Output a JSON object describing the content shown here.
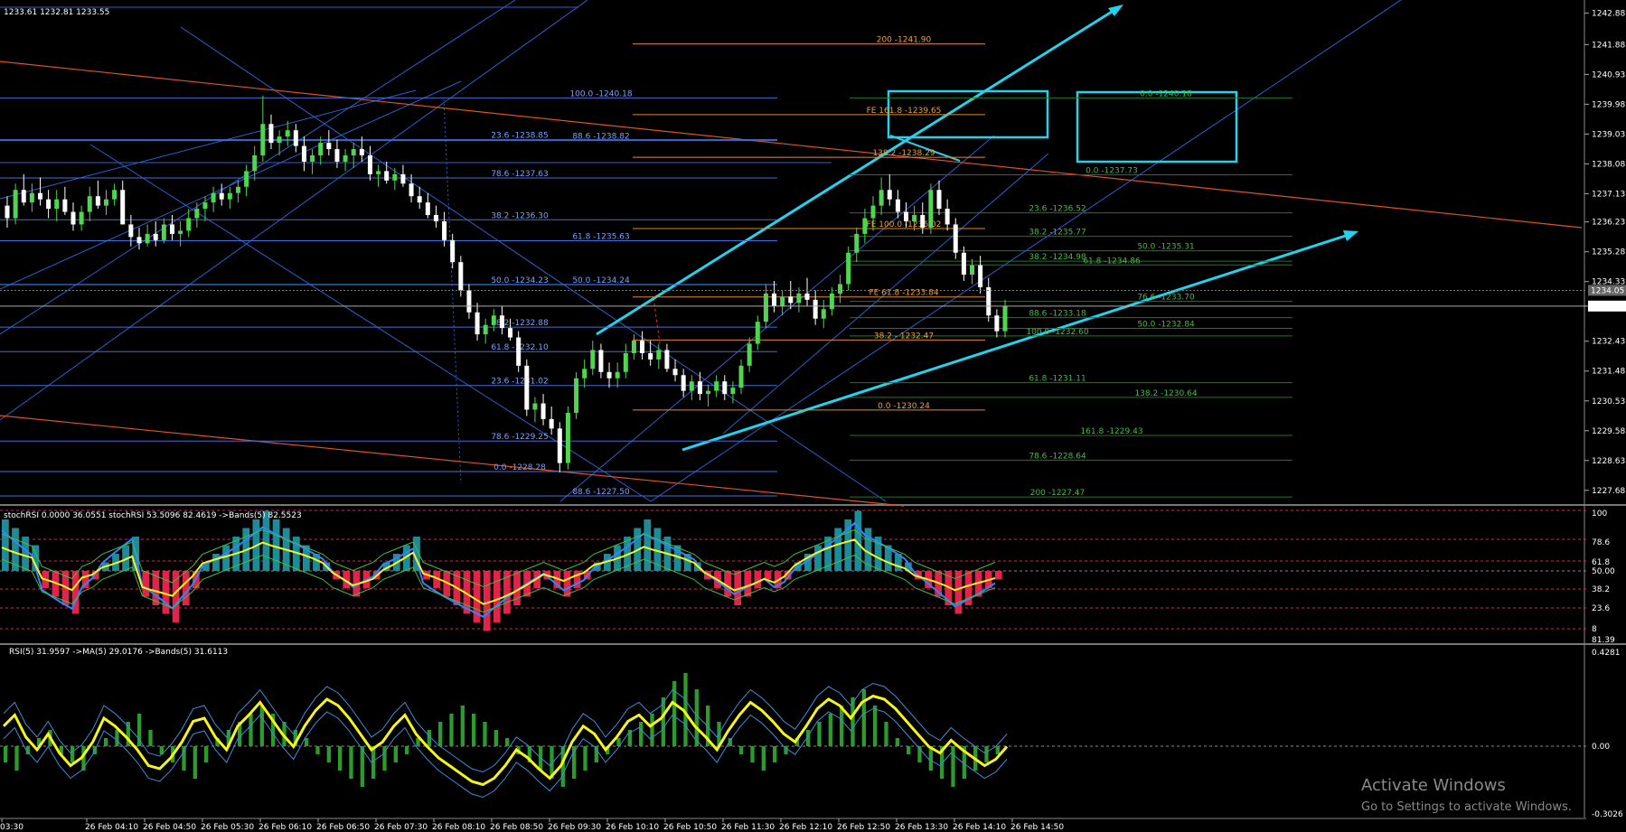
{
  "header": {
    "ohlc": "1233.61 1232.81 1233.55"
  },
  "colors": {
    "bull": "#4fd64f",
    "bear": "#ffffff",
    "blueline": "#2d5fcf",
    "orange": "#e08a2c",
    "green": "#1c7d1c",
    "cyan": "#22d3ee",
    "red": "#e0244a",
    "yellow": "#f5f51a",
    "stochblue": "#2e86ff"
  },
  "price_axis": {
    "ticks": [
      "1242.88",
      "1241.88",
      "1240.93",
      "1239.98",
      "1239.03",
      "1238.08",
      "1237.13",
      "1236.23",
      "1235.28",
      "1234.33",
      "1233.55",
      "1232.43",
      "1231.48",
      "1230.53",
      "1229.58",
      "1228.63",
      "1227.68"
    ],
    "current_price": "1233.55",
    "marker_price": "1234.05"
  },
  "stoch_axis": {
    "ticks": [
      "100",
      "78.6",
      "61.8",
      "50.00",
      "38.2",
      "23.6",
      "8",
      "81.39"
    ]
  },
  "rsi_axis": {
    "ticks": [
      "0.4281",
      "0.00",
      "-0.3026"
    ]
  },
  "time_axis": {
    "labels": [
      "03:30",
      "26 Feb 04:10",
      "26 Feb 04:50",
      "26 Feb 05:30",
      "26 Feb 06:10",
      "26 Feb 06:50",
      "26 Feb 07:30",
      "26 Feb 08:10",
      "26 Feb 08:50",
      "26 Feb 09:30",
      "26 Feb 10:10",
      "26 Feb 10:50",
      "26 Feb 11:30",
      "26 Feb 12:10",
      "26 Feb 12:50",
      "26 Feb 13:30",
      "26 Feb 14:10",
      "26 Feb 14:50"
    ]
  },
  "fib_labels": [
    {
      "text": "200 -1241.90",
      "price": 1241.9,
      "color": "orange"
    },
    {
      "text": "100.0 -1240.18",
      "price": 1240.18,
      "color": "blue"
    },
    {
      "text": "0.0 -1240.18",
      "price": 1240.18,
      "color": "green"
    },
    {
      "text": "FE 161.8 -1239.65",
      "price": 1239.65,
      "color": "orange"
    },
    {
      "text": "23.6 -1238.85",
      "price": 1238.85,
      "color": "blue"
    },
    {
      "text": "88.6 -1238.82",
      "price": 1238.82,
      "color": "blue"
    },
    {
      "text": "138.2 -1238.29",
      "price": 1238.29,
      "color": "orange"
    },
    {
      "text": "0.0 -1237.73",
      "price": 1237.73,
      "color": "green"
    },
    {
      "text": "78.6 -1237.63",
      "price": 1237.63,
      "color": "blue"
    },
    {
      "text": "23.6 -1236.52",
      "price": 1236.52,
      "color": "green"
    },
    {
      "text": "38.2 -1236.30",
      "price": 1236.3,
      "color": "blue"
    },
    {
      "text": "FE 100.0 -1236.02",
      "price": 1236.02,
      "color": "orange"
    },
    {
      "text": "38.2 -1235.77",
      "price": 1235.77,
      "color": "green"
    },
    {
      "text": "61.8 -1235.63",
      "price": 1235.63,
      "color": "blue"
    },
    {
      "text": "50.0 -1235.31",
      "price": 1235.31,
      "color": "green"
    },
    {
      "text": "38.2 -1234.98",
      "price": 1234.98,
      "color": "green"
    },
    {
      "text": "61.8 -1234.86",
      "price": 1234.86,
      "color": "green"
    },
    {
      "text": "50.0 -1234.24",
      "price": 1234.24,
      "color": "blue"
    },
    {
      "text": "50.0 -1234.23",
      "price": 1234.23,
      "color": "blue"
    },
    {
      "text": "FE 61.8 -1233.84",
      "price": 1233.84,
      "color": "orange"
    },
    {
      "text": "76.6 -1233.70",
      "price": 1233.7,
      "color": "green"
    },
    {
      "text": "88.6 -1233.18",
      "price": 1233.18,
      "color": "green"
    },
    {
      "text": "38.2 -1232.88",
      "price": 1232.88,
      "color": "blue"
    },
    {
      "text": "50.0 -1232.84",
      "price": 1232.84,
      "color": "green"
    },
    {
      "text": "100.0 -1232.60",
      "price": 1232.6,
      "color": "green"
    },
    {
      "text": "38.2 - 1232.47",
      "price": 1232.47,
      "color": "orange"
    },
    {
      "text": "61.8 -1232.10",
      "price": 1232.1,
      "color": "blue"
    },
    {
      "text": "61.8 -1231.11",
      "price": 1231.11,
      "color": "green"
    },
    {
      "text": "23.6 -1231.02",
      "price": 1231.02,
      "color": "blue"
    },
    {
      "text": "138.2 -1230.64",
      "price": 1230.64,
      "color": "green"
    },
    {
      "text": "0.0 -1230.24",
      "price": 1230.24,
      "color": "orange"
    },
    {
      "text": "161.8 -1229.43",
      "price": 1229.43,
      "color": "green"
    },
    {
      "text": "78.6 -1229.25",
      "price": 1229.25,
      "color": "blue"
    },
    {
      "text": "78.6 -1228.64",
      "price": 1228.64,
      "color": "green"
    },
    {
      "text": "0.0 -1228.28",
      "price": 1228.28,
      "color": "blue"
    },
    {
      "text": "88.6 -1227.50",
      "price": 1227.5,
      "color": "blue"
    },
    {
      "text": "200 -1227.47",
      "price": 1227.47,
      "color": "green"
    }
  ],
  "stoch_legend": "stochRSI 0.0000 36.0551  stochRSI 53.5096 82.4619  ->Bands(5) 82.5523",
  "rsi_legend": "RSI(5) 31.9597  ->MA(5) 29.0176  ->Bands(5) 31.6113",
  "watermark": {
    "title": "Activate Windows",
    "subtitle": "Go to Settings to activate Windows."
  },
  "chart_data": {
    "type": "candlestick",
    "price_range": [
      1227.3,
      1243.3
    ],
    "ohlc": [
      [
        1236.75,
        1237.05,
        1236.05,
        1236.35
      ],
      [
        1236.35,
        1237.45,
        1236.15,
        1237.25
      ],
      [
        1237.25,
        1237.75,
        1236.75,
        1236.85
      ],
      [
        1236.85,
        1237.45,
        1236.55,
        1237.15
      ],
      [
        1237.15,
        1237.65,
        1236.75,
        1236.95
      ],
      [
        1236.95,
        1237.25,
        1236.35,
        1236.65
      ],
      [
        1236.65,
        1237.25,
        1236.25,
        1236.95
      ],
      [
        1236.95,
        1237.35,
        1236.45,
        1236.55
      ],
      [
        1236.55,
        1236.85,
        1235.95,
        1236.15
      ],
      [
        1236.15,
        1236.75,
        1235.95,
        1236.55
      ],
      [
        1236.55,
        1237.35,
        1236.25,
        1237.05
      ],
      [
        1237.05,
        1237.55,
        1236.65,
        1236.75
      ],
      [
        1236.75,
        1237.25,
        1236.45,
        1236.95
      ],
      [
        1236.95,
        1237.45,
        1236.75,
        1237.25
      ],
      [
        1237.25,
        1237.55,
        1236.45,
        1236.15
      ],
      [
        1236.15,
        1236.45,
        1235.45,
        1235.75
      ],
      [
        1235.75,
        1236.05,
        1235.35,
        1235.55
      ],
      [
        1235.55,
        1236.15,
        1235.45,
        1235.85
      ],
      [
        1235.85,
        1236.25,
        1235.45,
        1235.65
      ],
      [
        1235.65,
        1236.35,
        1235.55,
        1236.15
      ],
      [
        1236.15,
        1236.45,
        1235.65,
        1235.85
      ],
      [
        1235.85,
        1236.25,
        1235.45,
        1235.95
      ],
      [
        1235.95,
        1236.65,
        1235.75,
        1236.35
      ],
      [
        1236.35,
        1236.85,
        1236.05,
        1236.65
      ],
      [
        1236.65,
        1237.05,
        1236.25,
        1236.85
      ],
      [
        1236.85,
        1237.35,
        1236.55,
        1237.15
      ],
      [
        1237.15,
        1237.45,
        1236.75,
        1236.95
      ],
      [
        1236.95,
        1237.35,
        1236.65,
        1237.15
      ],
      [
        1237.15,
        1237.55,
        1236.85,
        1237.35
      ],
      [
        1237.35,
        1238.05,
        1237.05,
        1237.85
      ],
      [
        1237.85,
        1238.65,
        1237.55,
        1238.35
      ],
      [
        1238.35,
        1240.25,
        1238.15,
        1239.35
      ],
      [
        1239.35,
        1239.65,
        1238.55,
        1238.75
      ],
      [
        1238.75,
        1239.15,
        1238.35,
        1238.95
      ],
      [
        1238.95,
        1239.45,
        1238.65,
        1239.15
      ],
      [
        1239.15,
        1239.35,
        1238.45,
        1238.65
      ],
      [
        1238.65,
        1238.95,
        1237.85,
        1238.15
      ],
      [
        1238.15,
        1238.55,
        1237.75,
        1238.35
      ],
      [
        1238.35,
        1238.95,
        1238.05,
        1238.75
      ],
      [
        1238.75,
        1239.15,
        1238.35,
        1238.55
      ],
      [
        1238.55,
        1238.85,
        1237.95,
        1238.15
      ],
      [
        1238.15,
        1238.55,
        1237.85,
        1238.35
      ],
      [
        1238.35,
        1238.75,
        1237.95,
        1238.55
      ],
      [
        1238.55,
        1238.95,
        1238.15,
        1238.35
      ],
      [
        1238.35,
        1238.65,
        1237.55,
        1237.75
      ],
      [
        1237.75,
        1238.05,
        1237.35,
        1237.85
      ],
      [
        1237.85,
        1238.15,
        1237.45,
        1237.55
      ],
      [
        1237.55,
        1237.95,
        1237.25,
        1237.75
      ],
      [
        1237.75,
        1238.05,
        1237.35,
        1237.45
      ],
      [
        1237.45,
        1237.75,
        1236.85,
        1237.05
      ],
      [
        1237.05,
        1237.35,
        1236.65,
        1236.85
      ],
      [
        1236.85,
        1237.15,
        1236.35,
        1236.45
      ],
      [
        1236.45,
        1236.75,
        1236.05,
        1236.25
      ],
      [
        1236.25,
        1236.55,
        1235.45,
        1235.65
      ],
      [
        1235.65,
        1235.85,
        1234.75,
        1234.95
      ],
      [
        1234.95,
        1235.15,
        1233.85,
        1234.05
      ],
      [
        1234.05,
        1234.25,
        1233.15,
        1233.35
      ],
      [
        1233.35,
        1233.65,
        1232.45,
        1232.65
      ],
      [
        1232.65,
        1233.15,
        1232.35,
        1232.95
      ],
      [
        1232.95,
        1233.45,
        1232.75,
        1233.25
      ],
      [
        1233.25,
        1233.55,
        1232.65,
        1232.85
      ],
      [
        1232.85,
        1233.15,
        1232.45,
        1232.55
      ],
      [
        1232.55,
        1232.75,
        1231.45,
        1231.65
      ],
      [
        1231.65,
        1231.85,
        1230.05,
        1230.25
      ],
      [
        1230.25,
        1230.65,
        1229.85,
        1230.45
      ],
      [
        1230.45,
        1230.75,
        1229.75,
        1229.95
      ],
      [
        1229.95,
        1230.35,
        1229.45,
        1229.65
      ],
      [
        1229.65,
        1229.85,
        1228.25,
        1228.55
      ],
      [
        1228.55,
        1230.35,
        1228.35,
        1230.15
      ],
      [
        1230.15,
        1231.45,
        1229.95,
        1231.25
      ],
      [
        1231.25,
        1231.85,
        1230.95,
        1231.55
      ],
      [
        1231.55,
        1232.45,
        1231.35,
        1232.15
      ],
      [
        1232.15,
        1232.35,
        1231.25,
        1231.45
      ],
      [
        1231.45,
        1231.75,
        1230.95,
        1231.25
      ],
      [
        1231.25,
        1231.75,
        1230.95,
        1231.45
      ],
      [
        1231.45,
        1232.35,
        1231.25,
        1232.05
      ],
      [
        1232.05,
        1232.65,
        1231.85,
        1232.45
      ],
      [
        1232.45,
        1232.75,
        1231.85,
        1232.05
      ],
      [
        1232.05,
        1232.45,
        1231.65,
        1231.85
      ],
      [
        1231.85,
        1232.35,
        1231.55,
        1232.15
      ],
      [
        1232.15,
        1232.35,
        1231.45,
        1231.55
      ],
      [
        1231.55,
        1231.85,
        1231.15,
        1231.35
      ],
      [
        1231.35,
        1231.55,
        1230.65,
        1230.85
      ],
      [
        1230.85,
        1231.35,
        1230.55,
        1231.15
      ],
      [
        1231.15,
        1231.45,
        1230.55,
        1230.75
      ],
      [
        1230.75,
        1231.05,
        1230.35,
        1230.85
      ],
      [
        1230.85,
        1231.35,
        1230.65,
        1231.15
      ],
      [
        1231.15,
        1231.35,
        1230.55,
        1230.75
      ],
      [
        1230.75,
        1231.15,
        1230.45,
        1230.95
      ],
      [
        1230.95,
        1231.85,
        1230.75,
        1231.65
      ],
      [
        1231.65,
        1232.55,
        1231.45,
        1232.35
      ],
      [
        1232.35,
        1233.25,
        1232.15,
        1233.05
      ],
      [
        1233.05,
        1234.25,
        1232.85,
        1233.95
      ],
      [
        1233.95,
        1234.35,
        1233.35,
        1233.55
      ],
      [
        1233.55,
        1234.05,
        1233.25,
        1233.85
      ],
      [
        1233.85,
        1234.35,
        1233.45,
        1233.65
      ],
      [
        1233.65,
        1234.15,
        1233.35,
        1233.95
      ],
      [
        1233.95,
        1234.45,
        1233.55,
        1233.75
      ],
      [
        1233.75,
        1234.05,
        1232.95,
        1233.15
      ],
      [
        1233.15,
        1233.75,
        1232.85,
        1233.45
      ],
      [
        1233.45,
        1234.15,
        1233.25,
        1233.95
      ],
      [
        1233.95,
        1234.55,
        1233.65,
        1234.25
      ],
      [
        1234.25,
        1235.45,
        1234.05,
        1235.25
      ],
      [
        1235.25,
        1236.05,
        1234.95,
        1235.85
      ],
      [
        1235.85,
        1236.65,
        1235.55,
        1236.35
      ],
      [
        1236.35,
        1237.05,
        1235.95,
        1236.75
      ],
      [
        1236.75,
        1237.65,
        1236.45,
        1237.25
      ],
      [
        1237.25,
        1237.75,
        1236.75,
        1236.95
      ],
      [
        1236.95,
        1237.25,
        1236.35,
        1236.55
      ],
      [
        1236.55,
        1236.85,
        1236.05,
        1236.25
      ],
      [
        1236.25,
        1236.75,
        1235.95,
        1236.45
      ],
      [
        1236.45,
        1236.85,
        1235.85,
        1236.05
      ],
      [
        1236.05,
        1237.45,
        1235.85,
        1237.25
      ],
      [
        1237.25,
        1237.55,
        1236.45,
        1236.65
      ],
      [
        1236.65,
        1236.95,
        1235.95,
        1236.15
      ],
      [
        1236.15,
        1236.35,
        1235.05,
        1235.25
      ],
      [
        1235.25,
        1235.45,
        1234.35,
        1234.55
      ],
      [
        1234.55,
        1235.05,
        1234.25,
        1234.85
      ],
      [
        1234.85,
        1235.15,
        1233.95,
        1234.15
      ],
      [
        1234.15,
        1234.45,
        1233.05,
        1233.25
      ],
      [
        1233.25,
        1233.45,
        1232.55,
        1232.75
      ],
      [
        1232.75,
        1233.75,
        1232.55,
        1233.55
      ]
    ],
    "stoch_hist": [
      60,
      50,
      40,
      30,
      -20,
      -30,
      -40,
      -50,
      -20,
      -10,
      10,
      20,
      30,
      40,
      -30,
      -40,
      -50,
      -60,
      -40,
      -20,
      10,
      20,
      30,
      40,
      50,
      60,
      70,
      60,
      50,
      40,
      30,
      20,
      10,
      -10,
      -20,
      -30,
      -20,
      -10,
      10,
      20,
      30,
      40,
      -10,
      -20,
      -30,
      -40,
      -50,
      -60,
      -70,
      -60,
      -50,
      -40,
      -30,
      -20,
      -10,
      -20,
      -30,
      -20,
      -10,
      10,
      20,
      30,
      40,
      50,
      60,
      50,
      40,
      30,
      20,
      10,
      -10,
      -20,
      -30,
      -40,
      -30,
      -20,
      -10,
      -20,
      -10,
      10,
      20,
      30,
      40,
      50,
      60,
      70,
      50,
      40,
      30,
      20,
      10,
      -10,
      -20,
      -30,
      -40,
      -50,
      -40,
      -30,
      -20,
      -10
    ],
    "rsi_hist": [
      -20,
      -30,
      -10,
      10,
      20,
      -10,
      -20,
      -30,
      -10,
      10,
      20,
      30,
      40,
      20,
      -10,
      -20,
      -30,
      -40,
      -20,
      10,
      20,
      30,
      40,
      50,
      40,
      30,
      20,
      10,
      -10,
      -20,
      -30,
      -40,
      -50,
      -40,
      -30,
      -20,
      -10,
      10,
      20,
      30,
      40,
      50,
      40,
      30,
      20,
      10,
      -10,
      -20,
      -30,
      -40,
      -50,
      -40,
      -30,
      -20,
      -10,
      10,
      20,
      30,
      40,
      60,
      80,
      90,
      70,
      50,
      30,
      10,
      -10,
      -20,
      -30,
      -20,
      -10,
      10,
      20,
      30,
      40,
      50,
      60,
      70,
      50,
      30,
      10,
      -10,
      -20,
      -30,
      -40,
      -50,
      -40,
      -30,
      -20,
      -10
    ],
    "rsi_line": [
      55,
      62,
      48,
      40,
      50,
      38,
      30,
      35,
      45,
      60,
      55,
      48,
      40,
      30,
      28,
      35,
      45,
      58,
      60,
      48,
      40,
      55,
      62,
      70,
      60,
      50,
      42,
      55,
      65,
      72,
      68,
      60,
      50,
      40,
      45,
      55,
      62,
      50,
      42,
      35,
      30,
      25,
      20,
      18,
      22,
      30,
      40,
      35,
      28,
      22,
      30,
      45,
      55,
      50,
      40,
      48,
      58,
      62,
      55,
      60,
      70,
      65,
      55,
      48,
      40,
      52,
      62,
      70,
      65,
      58,
      50,
      45,
      55,
      66,
      72,
      68,
      60,
      70,
      74,
      72,
      66,
      58,
      50,
      42,
      38,
      46,
      40,
      35,
      30,
      34,
      42
    ]
  }
}
